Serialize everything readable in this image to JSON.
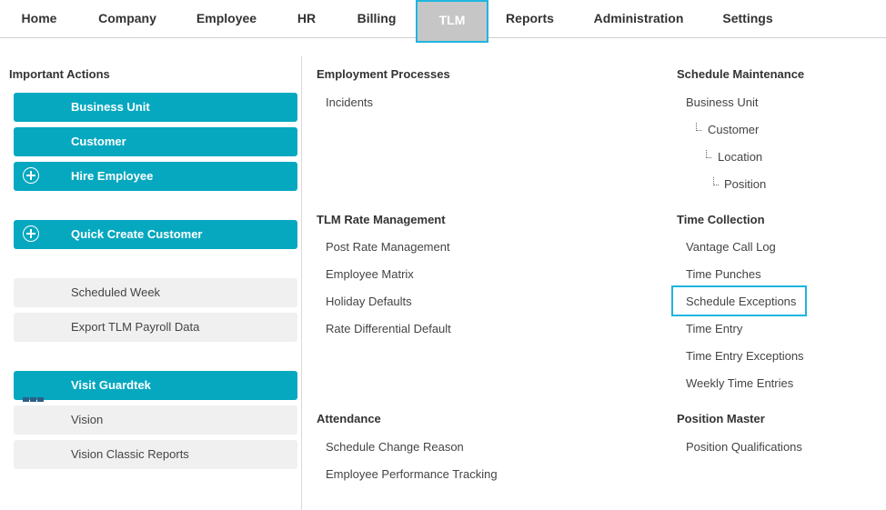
{
  "nav": {
    "home": "Home",
    "company": "Company",
    "employee": "Employee",
    "hr": "HR",
    "billing": "Billing",
    "tlm": "TLM",
    "reports": "Reports",
    "administration": "Administration",
    "settings": "Settings"
  },
  "important_actions": {
    "title": "Important Actions",
    "business_unit": "Business Unit",
    "customer": "Customer",
    "hire_employee": "Hire Employee",
    "quick_create_customer": "Quick Create Customer",
    "scheduled_week": "Scheduled Week",
    "export_tlm_payroll": "Export TLM Payroll Data",
    "visit_guardtek": "Visit Guardtek",
    "vision": "Vision",
    "vision_classic_reports": "Vision Classic Reports"
  },
  "employment_processes": {
    "title": "Employment Processes",
    "incidents": "Incidents"
  },
  "tlm_rate_management": {
    "title": "TLM Rate Management",
    "post_rate_management": "Post Rate Management",
    "employee_matrix": "Employee Matrix",
    "holiday_defaults": "Holiday Defaults",
    "rate_differential_default": "Rate Differential Default"
  },
  "attendance": {
    "title": "Attendance",
    "schedule_change_reason": "Schedule Change Reason",
    "employee_performance_tracking": "Employee Performance Tracking"
  },
  "schedule_maintenance": {
    "title": "Schedule Maintenance",
    "business_unit": "Business Unit",
    "customer": "Customer",
    "location": "Location",
    "position": "Position"
  },
  "time_collection": {
    "title": "Time Collection",
    "vantage_call_log": "Vantage Call Log",
    "time_punches": "Time Punches",
    "schedule_exceptions": "Schedule Exceptions",
    "time_entry": "Time Entry",
    "time_entry_exceptions": "Time Entry Exceptions",
    "weekly_time_entries": "Weekly Time Entries"
  },
  "position_master": {
    "title": "Position Master",
    "position_qualifications": "Position Qualifications"
  },
  "colors": {
    "primary_button": "#06a8c0",
    "highlight_border": "#1fb5e0",
    "active_tab": "#c6c6c6"
  }
}
